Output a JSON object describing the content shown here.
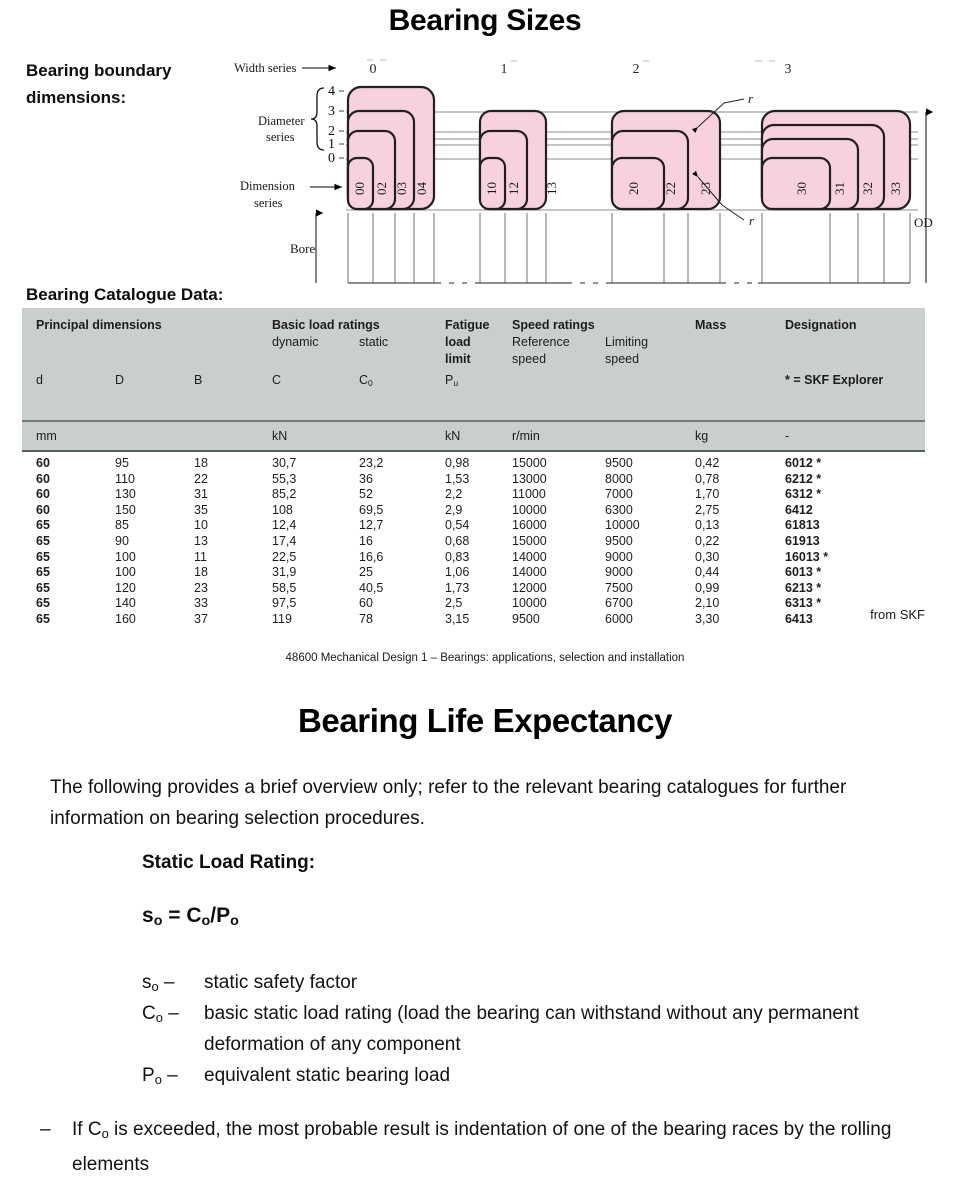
{
  "slide1": {
    "title": "Bearing Sizes",
    "side_heading_1": "Bearing boundary dimensions:",
    "side_heading_2": "Bearing Catalogue Data:",
    "from_source": "from SKF",
    "footer": "48600 Mechanical Design 1 – Bearings: applications, selection and installation",
    "diagram": {
      "width_series_label": "Width series",
      "diameter_series_label_1": "Diameter",
      "diameter_series_label_2": "series",
      "dimension_series_label_1": "Dimension",
      "dimension_series_label_2": "series",
      "bore_label": "Bore",
      "od_label": "OD",
      "fillet_label": "r",
      "width_series_ticks": [
        "0",
        "1",
        "2",
        "3"
      ],
      "diameter_series_ticks": [
        "4",
        "3",
        "2",
        "1",
        "0"
      ],
      "groups": [
        {
          "width_series": "0",
          "filled": [
            "04",
            "03",
            "02",
            "00"
          ],
          "outline": []
        },
        {
          "width_series": "1",
          "filled": [
            "12",
            "10"
          ],
          "outline": [
            "13"
          ]
        },
        {
          "width_series": "2",
          "filled": [
            "22",
            "20"
          ],
          "outline": [
            "23"
          ]
        },
        {
          "width_series": "3",
          "filled": [
            "32",
            "31",
            "30"
          ],
          "outline": [
            "33"
          ]
        }
      ]
    },
    "table": {
      "group_headers": [
        "Principal dimensions",
        "Basic load ratings",
        "Fatigue load limit",
        "Speed ratings",
        "Mass",
        "Designation"
      ],
      "sub_headers": {
        "dynamic": "dynamic",
        "static": "static",
        "reference_speed": "Reference speed",
        "limiting_speed": "Limiting speed"
      },
      "symbols": [
        "d",
        "D",
        "B",
        "C",
        "C₀",
        "Pᵤ",
        "",
        "",
        "",
        "* = SKF Explorer"
      ],
      "units": [
        "mm",
        "",
        "",
        "kN",
        "",
        "kN",
        "r/min",
        "",
        "kg",
        "-"
      ],
      "rows": [
        {
          "d": "60",
          "D": "95",
          "B": "18",
          "C": "30,7",
          "C0": "23,2",
          "Pu": "0,98",
          "ref": "15000",
          "lim": "9500",
          "mass": "0,42",
          "desig": "6012 *"
        },
        {
          "d": "60",
          "D": "110",
          "B": "22",
          "C": "55,3",
          "C0": "36",
          "Pu": "1,53",
          "ref": "13000",
          "lim": "8000",
          "mass": "0,78",
          "desig": "6212 *"
        },
        {
          "d": "60",
          "D": "130",
          "B": "31",
          "C": "85,2",
          "C0": "52",
          "Pu": "2,2",
          "ref": "11000",
          "lim": "7000",
          "mass": "1,70",
          "desig": "6312 *"
        },
        {
          "d": "60",
          "D": "150",
          "B": "35",
          "C": "108",
          "C0": "69,5",
          "Pu": "2,9",
          "ref": "10000",
          "lim": "6300",
          "mass": "2,75",
          "desig": "6412"
        },
        {
          "d": "65",
          "D": "85",
          "B": "10",
          "C": "12,4",
          "C0": "12,7",
          "Pu": "0,54",
          "ref": "16000",
          "lim": "10000",
          "mass": "0,13",
          "desig": "61813"
        },
        {
          "d": "65",
          "D": "90",
          "B": "13",
          "C": "17,4",
          "C0": "16",
          "Pu": "0,68",
          "ref": "15000",
          "lim": "9500",
          "mass": "0,22",
          "desig": "61913"
        },
        {
          "d": "65",
          "D": "100",
          "B": "11",
          "C": "22,5",
          "C0": "16,6",
          "Pu": "0,83",
          "ref": "14000",
          "lim": "9000",
          "mass": "0,30",
          "desig": "16013 *"
        },
        {
          "d": "65",
          "D": "100",
          "B": "18",
          "C": "31,9",
          "C0": "25",
          "Pu": "1,06",
          "ref": "14000",
          "lim": "9000",
          "mass": "0,44",
          "desig": "6013 *"
        },
        {
          "d": "65",
          "D": "120",
          "B": "23",
          "C": "58,5",
          "C0": "40,5",
          "Pu": "1,73",
          "ref": "12000",
          "lim": "7500",
          "mass": "0,99",
          "desig": "6213 *"
        },
        {
          "d": "65",
          "D": "140",
          "B": "33",
          "C": "97,5",
          "C0": "60",
          "Pu": "2,5",
          "ref": "10000",
          "lim": "6700",
          "mass": "2,10",
          "desig": "6313 *"
        },
        {
          "d": "65",
          "D": "160",
          "B": "37",
          "C": "119",
          "C0": "78",
          "Pu": "3,15",
          "ref": "9500",
          "lim": "6000",
          "mass": "3,30",
          "desig": "6413"
        }
      ]
    }
  },
  "slide2": {
    "title": "Bearing Life Expectancy",
    "intro": "The following provides a brief overview only; refer to the relevant bearing catalogues for further information on bearing selection procedures.",
    "sub_heading": "Static Load Rating:",
    "formula_s": "s",
    "formula_rest": " = C",
    "definitions": [
      {
        "symbol": "s",
        "sub": "o",
        "dash": "–",
        "text": "static safety factor"
      },
      {
        "symbol": "C",
        "sub": "o",
        "dash": "–",
        "text": "basic static load rating (load the bearing can withstand without any permanent deformation of any component"
      },
      {
        "symbol": "P",
        "sub": "o",
        "dash": "–",
        "text": "equivalent static bearing load"
      }
    ],
    "bullet": {
      "dash": "–",
      "text_before": "If C",
      "sub": "o",
      "text_after": " is exceeded, the most probable result is indentation of one of the bearing races by the rolling elements"
    }
  },
  "colors": {
    "bearing_fill": "#f7d2dc",
    "bearing_stroke": "#231f20",
    "table_header_bg": "#cacecc",
    "rule": "#50605a"
  }
}
